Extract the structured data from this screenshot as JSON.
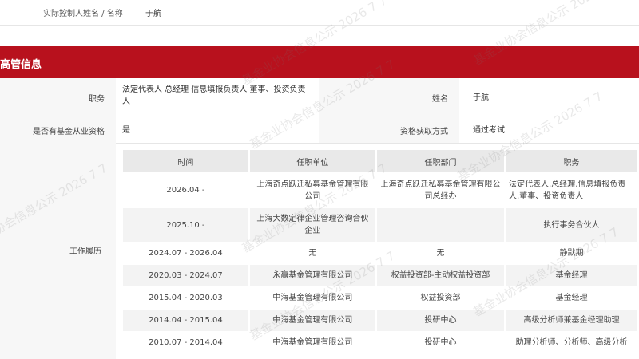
{
  "controller": {
    "label": "实际控制人姓名 / 名称",
    "value": "于航"
  },
  "section": {
    "title": "高管信息"
  },
  "info": {
    "position_label": "职务",
    "position_value": "法定代表人 总经理 信息填报负责人 董事、投资负责人",
    "name_label": "姓名",
    "name_value": "于航",
    "qualified_label": "是否有基金从业资格",
    "qualified_value": "是",
    "method_label": "资格获取方式",
    "method_value": "通过考试"
  },
  "work": {
    "label": "工作履历",
    "headers": [
      "时间",
      "任职单位",
      "任职部门",
      "职务"
    ],
    "rows": [
      [
        "2026.04 -",
        "上海奇点跃迁私募基金管理有限公司",
        "上海奇点跃迁私募基金管理有限公司总经办",
        "法定代表人,总经理,信息填报负责人,董事、投资负责人"
      ],
      [
        "2025.10 -",
        "上海大数定律企业管理咨询合伙企业",
        "",
        "执行事务合伙人"
      ],
      [
        "2024.07 - 2026.04",
        "无",
        "无",
        "静默期"
      ],
      [
        "2020.03 - 2024.07",
        "永赢基金管理有限公司",
        "权益投资部-主动权益投资部",
        "基金经理"
      ],
      [
        "2015.04 - 2020.03",
        "中海基金管理有限公司",
        "权益投资部",
        "基金经理"
      ],
      [
        "2014.04 - 2015.04",
        "中海基金管理有限公司",
        "投研中心",
        "高级分析师兼基金经理助理"
      ],
      [
        "2010.07 - 2014.04",
        "中海基金管理有限公司",
        "投研中心",
        "助理分析师、分析师、高级分析"
      ]
    ]
  },
  "watermark": "基金业协会信息公示 2026 7 7"
}
